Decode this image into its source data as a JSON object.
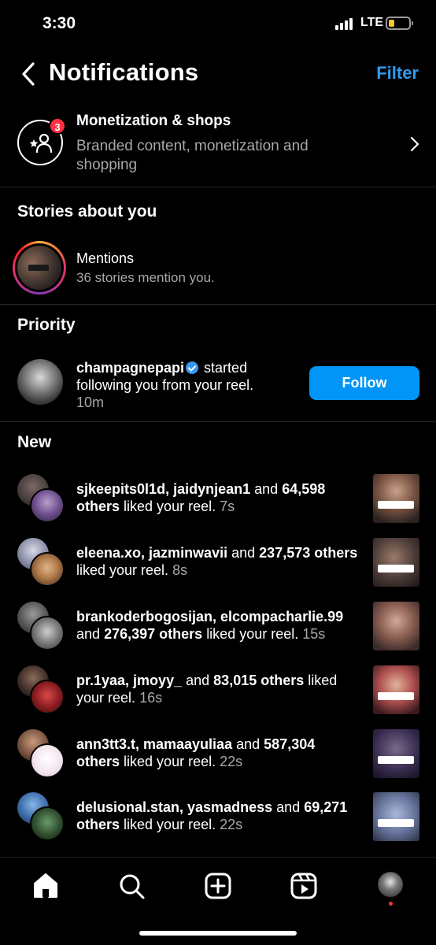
{
  "status_bar": {
    "time": "3:30",
    "network": "LTE",
    "battery_level": 0.2,
    "battery_color": "#f3c82f"
  },
  "header": {
    "title": "Notifications",
    "filter_label": "Filter",
    "back_icon": "chevron-left-icon"
  },
  "monetization": {
    "title": "Monetization & shops",
    "subtitle": "Branded content, monetization and shopping",
    "badge_count": "3",
    "icon": "star-person-icon"
  },
  "sections": {
    "stories": "Stories about you",
    "priority": "Priority",
    "new": "New"
  },
  "mentions": {
    "title": "Mentions",
    "subtitle": "36 stories mention you."
  },
  "priority_item": {
    "username": "champagnepapi",
    "text": "started following you from your reel.",
    "time": "10m",
    "follow_label": "Follow"
  },
  "notifications": [
    {
      "users": "sjkeepits0l1d, jaidynjean1",
      "and": "and",
      "count": "64,598",
      "others": "others",
      "action": "liked your reel.",
      "time": "7s"
    },
    {
      "users": "eleena.xo, jazminwavii",
      "and": "and",
      "count": "237,573",
      "others": "others",
      "action": "liked your reel.",
      "time": "8s"
    },
    {
      "users": "brankoderbogosijan, elcompacharlie.99",
      "and": "and",
      "count": "276,397",
      "others": "others",
      "action": "liked your reel.",
      "time": "15s"
    },
    {
      "users": "pr.1yaa, jmoyy_",
      "and": "and",
      "count": "83,015",
      "others": "others",
      "action": "liked your reel.",
      "time": "16s"
    },
    {
      "users": "ann3tt3.t, mamaayuliaa",
      "and": "and",
      "count": "587,304",
      "others": "others",
      "action": "liked your reel.",
      "time": "22s"
    },
    {
      "users": "delusional.stan, yasmadness",
      "and": "and",
      "count": "69,271",
      "others": "others",
      "action": "liked your reel.",
      "time": "22s"
    }
  ],
  "colors": {
    "accent": "#0095f6",
    "filter": "#2f9bf0",
    "badge": "#ff3040",
    "secondary_text": "#a8a8a8"
  },
  "bottom_nav": [
    "home-icon",
    "search-icon",
    "create-icon",
    "reels-icon",
    "profile-avatar"
  ]
}
